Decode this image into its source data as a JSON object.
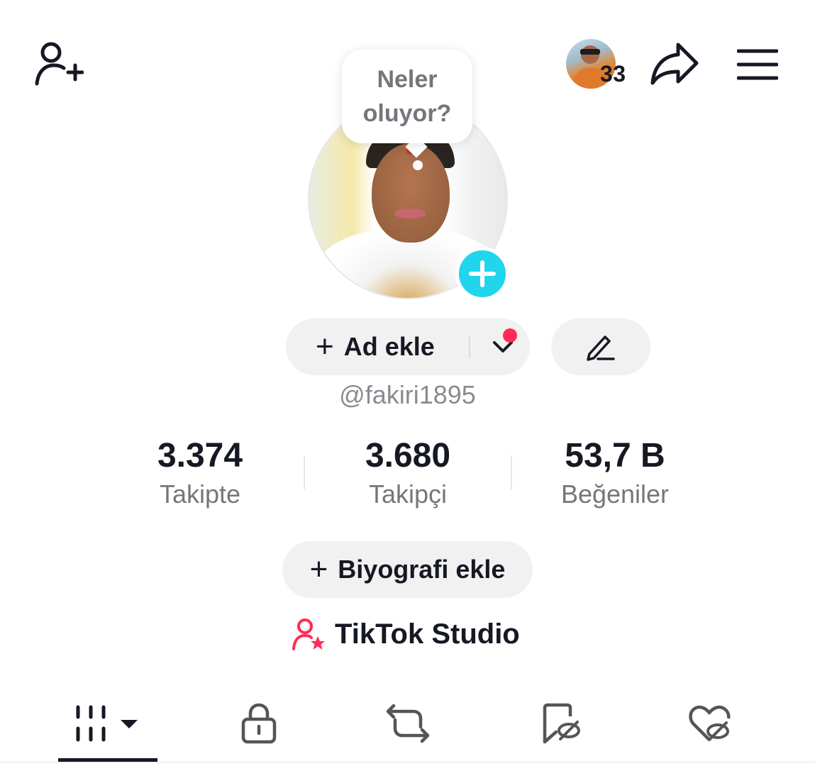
{
  "header": {
    "add_friend_icon": "person-plus-icon",
    "friends_count": "33",
    "share_icon": "share-arrow-icon",
    "menu_icon": "hamburger-menu-icon"
  },
  "status_bubble": {
    "text": "Neler oluyor?"
  },
  "profile": {
    "add_name_label": "Ad ekle",
    "username": "@fakiri1895",
    "accent_color": "#20d5ec",
    "notification_color": "#fe2c55"
  },
  "stats": [
    {
      "value": "3.374",
      "label": "Takipte"
    },
    {
      "value": "3.680",
      "label": "Takipçi"
    },
    {
      "value": "53,7 B",
      "label": "Beğeniler"
    }
  ],
  "bio": {
    "add_bio_label": "Biyografi ekle"
  },
  "studio": {
    "label": "TikTok Studio"
  },
  "tabs": [
    {
      "icon": "video-grid-icon",
      "active": true
    },
    {
      "icon": "lock-icon",
      "active": false
    },
    {
      "icon": "repost-icon",
      "active": false
    },
    {
      "icon": "saved-hidden-icon",
      "active": false
    },
    {
      "icon": "liked-hidden-icon",
      "active": false
    }
  ]
}
